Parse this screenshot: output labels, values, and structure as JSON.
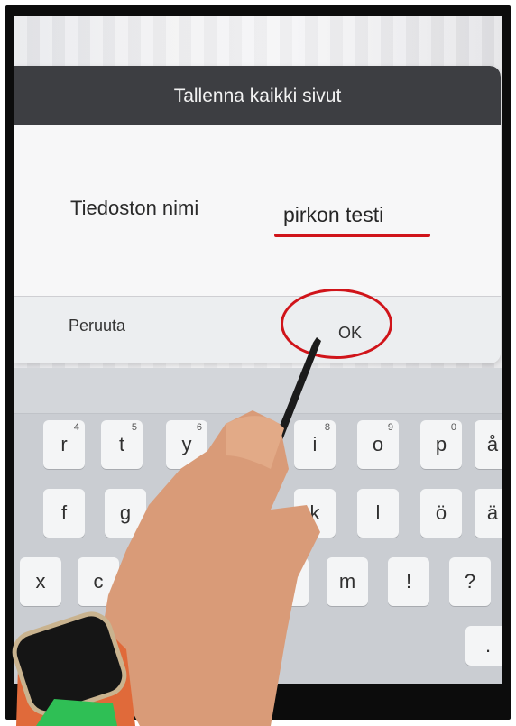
{
  "dialog": {
    "title": "Tallenna kaikki sivut",
    "field_label": "Tiedoston nimi",
    "field_value": "pirkon testi",
    "cancel_label": "Peruuta",
    "ok_label": "OK"
  },
  "keyboard": {
    "row1": [
      {
        "key": "r",
        "hint": "4"
      },
      {
        "key": "t",
        "hint": "5"
      },
      {
        "key": "y",
        "hint": "6"
      },
      {
        "key": "i",
        "hint": "8"
      },
      {
        "key": "o",
        "hint": "9"
      },
      {
        "key": "p",
        "hint": "0"
      },
      {
        "key": "å",
        "hint": ""
      }
    ],
    "row2": [
      "f",
      "g",
      "k",
      "l",
      "ö",
      "ä"
    ],
    "row3": [
      "x",
      "c",
      "n",
      "m",
      "!",
      "?"
    ]
  },
  "colors": {
    "header": "#3d3e42",
    "annotation": "#d0141a",
    "input_underline": "#2f6fd2"
  }
}
